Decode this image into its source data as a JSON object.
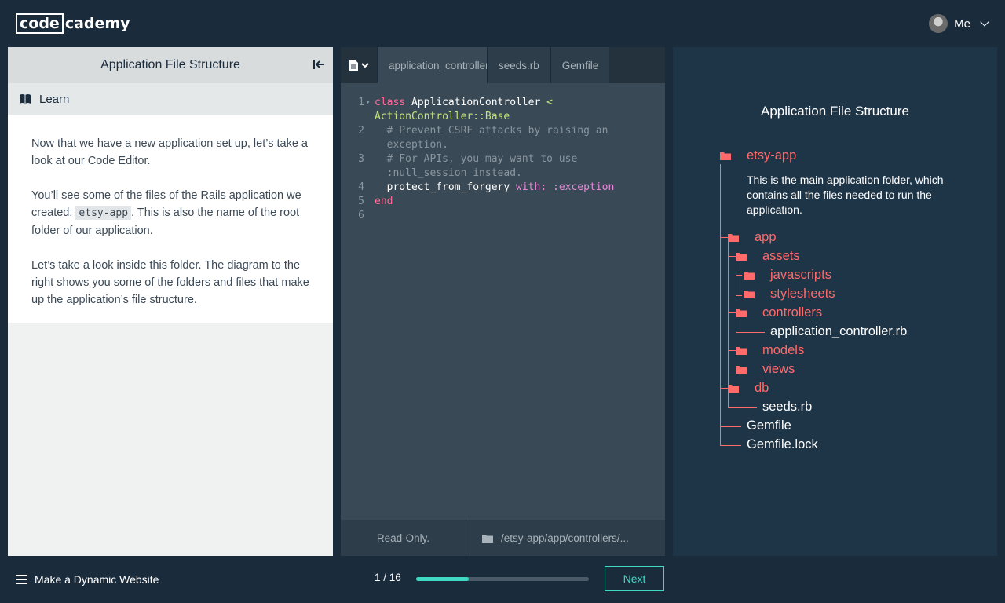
{
  "header": {
    "logo_box": "code",
    "logo_rest": "cademy",
    "user_label": "Me"
  },
  "lesson": {
    "title": "Application File Structure",
    "tab_label": "Learn",
    "p1": "Now that we have a new application set up, let’s take a look at our Code Editor.",
    "p2_before": "You’ll see some of the files of the Rails application we created: ",
    "p2_code": "etsy-app",
    "p2_after": ". This is also the name of the root folder of our application.",
    "p3": "Let’s take a look inside this folder. The diagram to the right shows you some of the folders and files that make up the application’s file structure."
  },
  "editor": {
    "tabs": [
      "application_controller.rb",
      "seeds.rb",
      "Gemfile"
    ],
    "line_numbers": [
      "1",
      "2",
      "3",
      "4",
      "5",
      "6"
    ],
    "lines": {
      "l1_kw": "class",
      "l1_cls": " ApplicationController ",
      "l1_lt": "<",
      "l1_sup": "ActionController::Base",
      "l2": "  # Prevent CSRF attacks by raising an\n  exception.",
      "l3": "  # For APIs, you may want to use\n  :null_session instead.",
      "l4_call": "  protect_from_forgery ",
      "l4_with": "with: ",
      "l4_sym": ":exception",
      "l5": "end"
    },
    "footer_status": "Read-Only.",
    "footer_path": "/etsy-app/app/controllers/..."
  },
  "diagram": {
    "title": "Application File Structure",
    "root": "etsy-app",
    "root_desc": "This is the main application folder, which contains all the files needed to run the application.",
    "app": "app",
    "assets": "assets",
    "javascripts": "javascripts",
    "stylesheets": "stylesheets",
    "controllers": "controllers",
    "app_controller": "application_controller.rb",
    "models": "models",
    "views": "views",
    "db": "db",
    "seeds": "seeds.rb",
    "gemfile": "Gemfile",
    "gemfile_lock": "Gemfile.lock"
  },
  "footer": {
    "course": "Make a Dynamic Website",
    "progress_text": "1 / 16",
    "progress_fraction": 0.305,
    "next_label": "Next"
  },
  "colors": {
    "background": "#1a2b3c",
    "accent": "#3fd9c3",
    "folder": "#ff6b6b"
  }
}
